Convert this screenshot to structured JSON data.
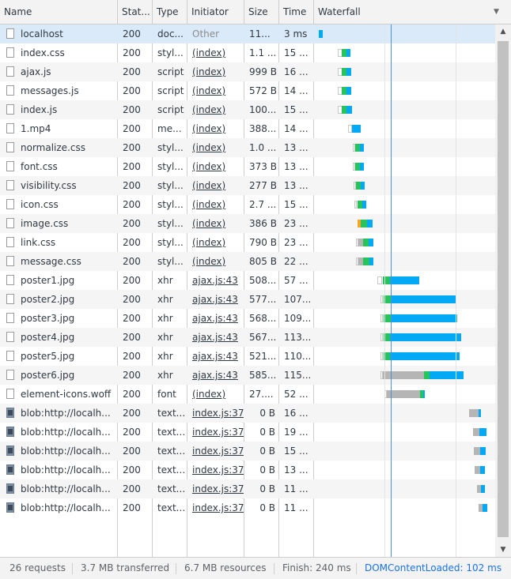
{
  "columns": {
    "name": "Name",
    "status": "Stat...",
    "type": "Type",
    "initiator": "Initiator",
    "size": "Size",
    "time": "Time",
    "waterfall": "Waterfall"
  },
  "icons": {
    "sort": "sort-descending-icon",
    "scroll_up": "scroll-up-icon",
    "scroll_down": "scroll-down-icon"
  },
  "colors": {
    "waiting": "#b5b5b5",
    "queued": "#c8c8c8",
    "ttfb": "#26c45a",
    "download": "#03a9f4",
    "stalled": "#f5a623",
    "dom_content_loaded": "#4c8fdc"
  },
  "rows": [
    {
      "name": "localhost",
      "status": "200",
      "type": "doc...",
      "initiator": "Other",
      "size": "11...",
      "time": "3 ms",
      "icon": "document-icon"
    },
    {
      "name": "index.css",
      "status": "200",
      "type": "styl...",
      "initiator": "(index)",
      "size": "1.1 ...",
      "time": "15 ...",
      "icon": "document-icon"
    },
    {
      "name": "ajax.js",
      "status": "200",
      "type": "script",
      "initiator": "(index)",
      "size": "999 B",
      "time": "16 ...",
      "icon": "document-icon"
    },
    {
      "name": "messages.js",
      "status": "200",
      "type": "script",
      "initiator": "(index)",
      "size": "572 B",
      "time": "14 ...",
      "icon": "document-icon"
    },
    {
      "name": "index.js",
      "status": "200",
      "type": "script",
      "initiator": "(index)",
      "size": "100...",
      "time": "15 ...",
      "icon": "document-icon"
    },
    {
      "name": "1.mp4",
      "status": "200",
      "type": "me...",
      "initiator": "(index)",
      "size": "388...",
      "time": "14 ...",
      "icon": "document-icon"
    },
    {
      "name": "normalize.css",
      "status": "200",
      "type": "styl...",
      "initiator": "(index)",
      "size": "1.0 ...",
      "time": "13 ...",
      "icon": "document-icon"
    },
    {
      "name": "font.css",
      "status": "200",
      "type": "styl...",
      "initiator": "(index)",
      "size": "373 B",
      "time": "13 ...",
      "icon": "document-icon"
    },
    {
      "name": "visibility.css",
      "status": "200",
      "type": "styl...",
      "initiator": "(index)",
      "size": "277 B",
      "time": "13 ...",
      "icon": "document-icon"
    },
    {
      "name": "icon.css",
      "status": "200",
      "type": "styl...",
      "initiator": "(index)",
      "size": "2.7 ...",
      "time": "15 ...",
      "icon": "document-icon"
    },
    {
      "name": "image.css",
      "status": "200",
      "type": "styl...",
      "initiator": "(index)",
      "size": "386 B",
      "time": "23 ...",
      "icon": "document-icon"
    },
    {
      "name": "link.css",
      "status": "200",
      "type": "styl...",
      "initiator": "(index)",
      "size": "790 B",
      "time": "23 ...",
      "icon": "document-icon"
    },
    {
      "name": "message.css",
      "status": "200",
      "type": "styl...",
      "initiator": "(index)",
      "size": "805 B",
      "time": "22 ...",
      "icon": "document-icon"
    },
    {
      "name": "poster1.jpg",
      "status": "200",
      "type": "xhr",
      "initiator": "ajax.js:43",
      "size": "508...",
      "time": "57 ...",
      "icon": "document-icon"
    },
    {
      "name": "poster2.jpg",
      "status": "200",
      "type": "xhr",
      "initiator": "ajax.js:43",
      "size": "577...",
      "time": "107...",
      "icon": "document-icon"
    },
    {
      "name": "poster3.jpg",
      "status": "200",
      "type": "xhr",
      "initiator": "ajax.js:43",
      "size": "568...",
      "time": "109...",
      "icon": "document-icon"
    },
    {
      "name": "poster4.jpg",
      "status": "200",
      "type": "xhr",
      "initiator": "ajax.js:43",
      "size": "567...",
      "time": "113...",
      "icon": "document-icon"
    },
    {
      "name": "poster5.jpg",
      "status": "200",
      "type": "xhr",
      "initiator": "ajax.js:43",
      "size": "521...",
      "time": "110...",
      "icon": "document-icon"
    },
    {
      "name": "poster6.jpg",
      "status": "200",
      "type": "xhr",
      "initiator": "ajax.js:43",
      "size": "585...",
      "time": "115...",
      "icon": "document-icon"
    },
    {
      "name": "element-icons.woff",
      "status": "200",
      "type": "font",
      "initiator": "(index)",
      "size": "27....",
      "time": "52 ...",
      "icon": "document-icon"
    },
    {
      "name": "blob:http://localh...",
      "status": "200",
      "type": "text...",
      "initiator": "index.js:37",
      "size": "0 B",
      "time": "16 ...",
      "icon": "image-thumbnail-icon"
    },
    {
      "name": "blob:http://localh...",
      "status": "200",
      "type": "text...",
      "initiator": "index.js:37",
      "size": "0 B",
      "time": "19 ...",
      "icon": "image-thumbnail-icon"
    },
    {
      "name": "blob:http://localh...",
      "status": "200",
      "type": "text...",
      "initiator": "index.js:37",
      "size": "0 B",
      "time": "15 ...",
      "icon": "image-thumbnail-icon"
    },
    {
      "name": "blob:http://localh...",
      "status": "200",
      "type": "text...",
      "initiator": "index.js:37",
      "size": "0 B",
      "time": "13 ...",
      "icon": "image-thumbnail-icon"
    },
    {
      "name": "blob:http://localh...",
      "status": "200",
      "type": "text...",
      "initiator": "index.js:37",
      "size": "0 B",
      "time": "11 ...",
      "icon": "image-thumbnail-icon"
    },
    {
      "name": "blob:http://localh...",
      "status": "200",
      "type": "text...",
      "initiator": "index.js:37",
      "size": "0 B",
      "time": "11 ...",
      "icon": "image-thumbnail-icon"
    }
  ],
  "footer": {
    "requests": "26 requests",
    "transferred": "3.7 MB transferred",
    "resources": "6.7 MB resources",
    "finish": "Finish: 240 ms",
    "dom_content_loaded": "DOMContentLoaded: 102 ms"
  }
}
